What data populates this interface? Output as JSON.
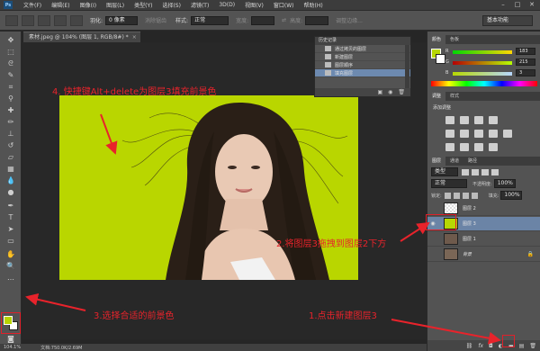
{
  "menubar": {
    "logo": "Ps",
    "items": [
      "文件(F)",
      "编辑(E)",
      "图像(I)",
      "图层(L)",
      "类型(Y)",
      "选择(S)",
      "滤镜(T)",
      "3D(D)",
      "视图(V)",
      "窗口(W)",
      "帮助(H)"
    ],
    "window_buttons": [
      "–",
      "□",
      "✕"
    ]
  },
  "options": {
    "feather_label": "羽化:",
    "feather_value": "0 像素",
    "antialias": "消除锯齿",
    "style_label": "样式:",
    "style_value": "正常",
    "width_label": "宽度:",
    "height_label": "高度:",
    "refine": "调整边缘...",
    "workspace": "基本功能"
  },
  "document": {
    "tab_title": "素材.jpeg @ 104% (图层 1, RGB/8#) *",
    "close": "×"
  },
  "statusbar": {
    "zoom": "104.1%",
    "doc_info": "文档:750.0K/2.69M"
  },
  "history": {
    "title": "历史记录",
    "items": [
      "通过拷贝的图层",
      "新建图层",
      "图层顺序",
      "填充图层"
    ],
    "active_index": 3
  },
  "color_panel": {
    "tabs": [
      "颜色",
      "色板"
    ],
    "r": "183",
    "g": "215",
    "b": "3",
    "r_label": "R",
    "g_label": "G",
    "b_label": "B",
    "fg_color": "#b7d703"
  },
  "adjustments": {
    "tabs": [
      "调整",
      "样式"
    ],
    "title": "添加调整"
  },
  "layers": {
    "tabs": [
      "图层",
      "通道",
      "路径"
    ],
    "filter": "类型",
    "blend": "正常",
    "opacity_label": "不透明度:",
    "opacity": "100%",
    "lock_label": "锁定:",
    "fill_label": "填充:",
    "fill": "100%",
    "rows": [
      {
        "name": "图层 2",
        "visible": false,
        "selected": false
      },
      {
        "name": "图层 3",
        "visible": true,
        "selected": true
      },
      {
        "name": "图层 1",
        "visible": false,
        "selected": false
      },
      {
        "name": "背景",
        "visible": false,
        "selected": false
      }
    ]
  },
  "annotations": {
    "step4": "4. 快捷键Alt+delete为图层3填充前景色",
    "step2": "2.将图层3拖拽到图层2下方",
    "step3": "3.选择合适的前景色",
    "step1": "1.点击新建图层3"
  },
  "colors": {
    "canvas_bg": "#b9d600",
    "annotation_red": "#e8232b",
    "selected_layer": "#6b84a6"
  }
}
